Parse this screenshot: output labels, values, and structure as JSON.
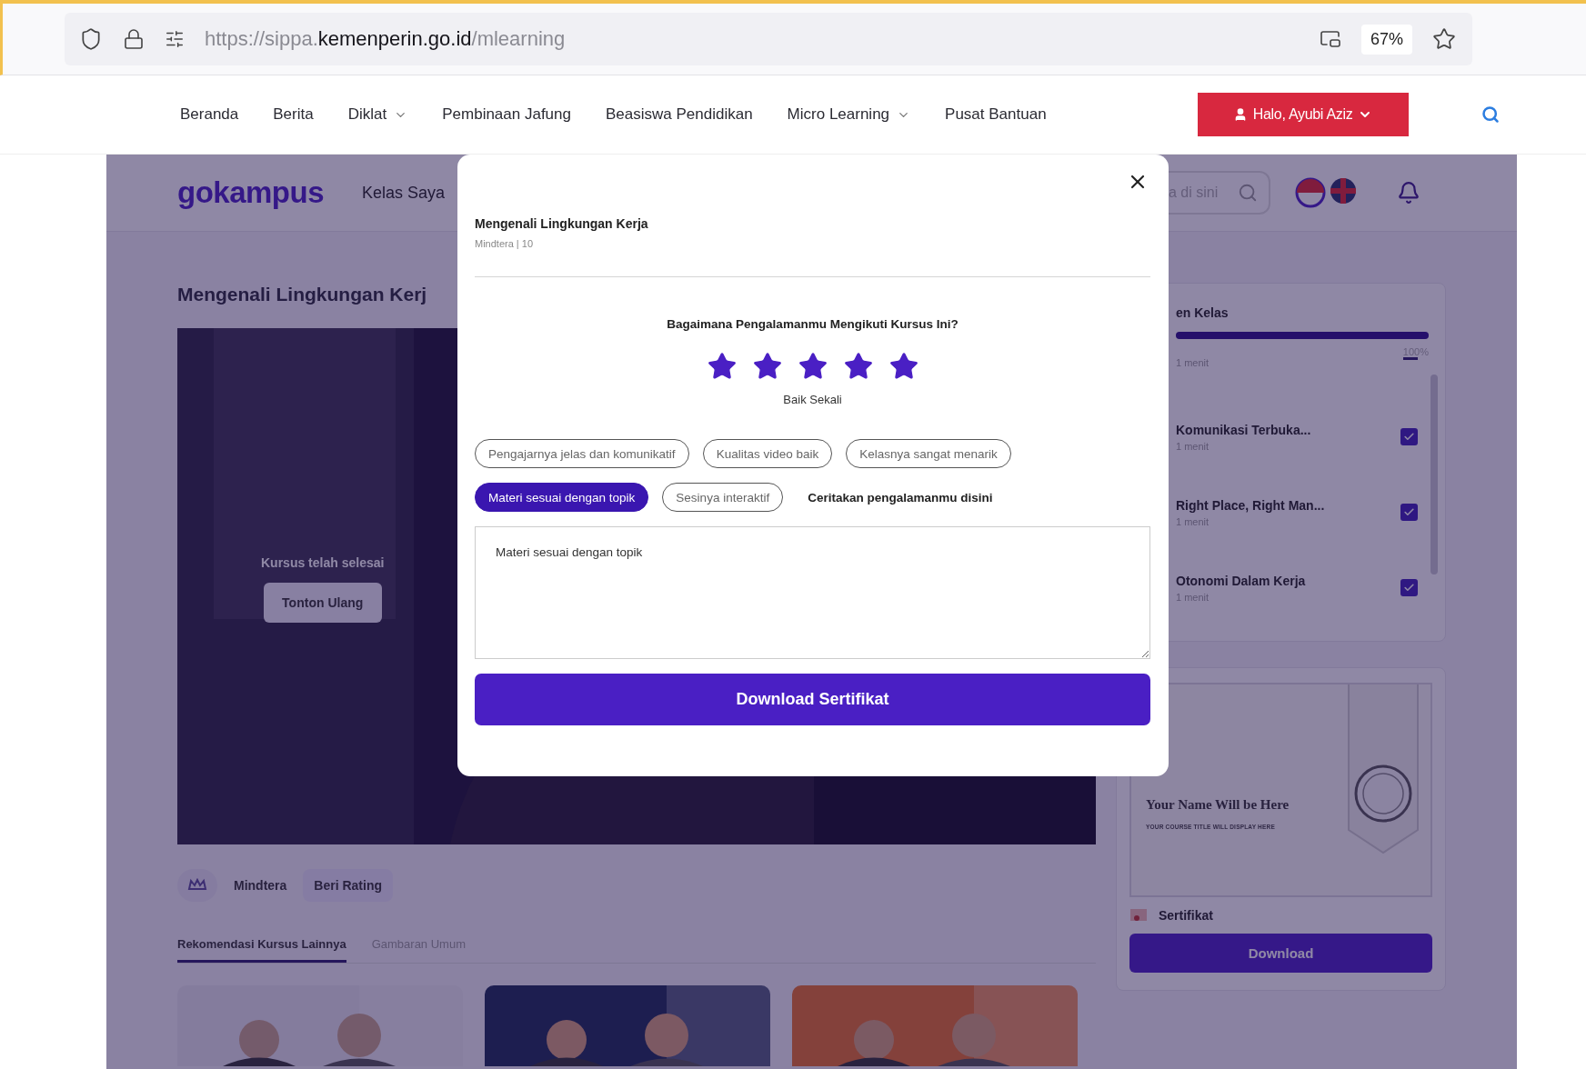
{
  "browser": {
    "url": "https://sippa.**kemenperin.go.id**/mlearning",
    "zoom": "67%"
  },
  "nav": {
    "items": [
      {
        "label": "Beranda",
        "dropdown": false
      },
      {
        "label": "Berita",
        "dropdown": false
      },
      {
        "label": "Diklat",
        "dropdown": true
      },
      {
        "label": "Pembinaan Jafung",
        "dropdown": false
      },
      {
        "label": "Beasiswa Pendidikan",
        "dropdown": false
      },
      {
        "label": "Micro Learning",
        "dropdown": true
      },
      {
        "label": "Pusat Bantuan",
        "dropdown": false
      }
    ],
    "user_button": "Halo, Ayubi Aziz"
  },
  "page": {
    "logo": "gokampus",
    "header_link": "Kelas Saya",
    "search_fragment": "a di sini",
    "title": "Mengenali Lingkungan Kerj",
    "video": {
      "kind": "picture",
      "status": "Kursus telah selesai",
      "replay_button": "Tonton Ulang"
    },
    "provider": "Mindtera",
    "rate_button": "Beri Rating",
    "tabs": [
      {
        "label": "Rekomendasi Kursus Lainnya",
        "selected": true
      },
      {
        "label": "Gambaran Umum",
        "selected": false
      }
    ],
    "progress": {
      "title": "en Kelas",
      "level": 1,
      "percent": "100%"
    },
    "lessons": [
      {
        "kind": "partial",
        "duration": "1 menit"
      },
      {
        "kind": "lesson",
        "title": "Komunikasi Terbuka...",
        "duration": "1 menit",
        "completed": true
      },
      {
        "kind": "lesson",
        "title": "Right Place, Right Man...",
        "duration": "1 menit",
        "completed": true
      },
      {
        "kind": "lesson",
        "title": "Otonomi Dalam Kerja",
        "duration": "1 menit",
        "completed": true
      }
    ],
    "certificate": {
      "name_placeholder": "Your Name Will be Here",
      "course_placeholder": "YOUR COURSE TITLE WILL DISPLAY HERE",
      "label": "Sertifikat",
      "button": "Download"
    }
  },
  "modal": {
    "title": "Mengenali Lingkungan Kerja",
    "subtitle": "Mindtera | 10",
    "question": "Bagaimana Pengalamanmu Mengikuti Kursus Ini?",
    "stars": 5,
    "rating_label": "Baik Sekali",
    "tags": [
      {
        "label": "Pengajarnya jelas dan komunikatif",
        "selected": false
      },
      {
        "label": "Kualitas video baik",
        "selected": false
      },
      {
        "label": "Kelasnya sangat menarik",
        "selected": false
      },
      {
        "label": "Materi sesuai dengan topik",
        "selected": true
      },
      {
        "label": "Sesinya interaktif",
        "selected": false
      }
    ],
    "comment_label": "Ceritakan pengalamanmu disini",
    "comment": "Materi sesuai dengan topik",
    "submit": "Download Sertifikat"
  }
}
